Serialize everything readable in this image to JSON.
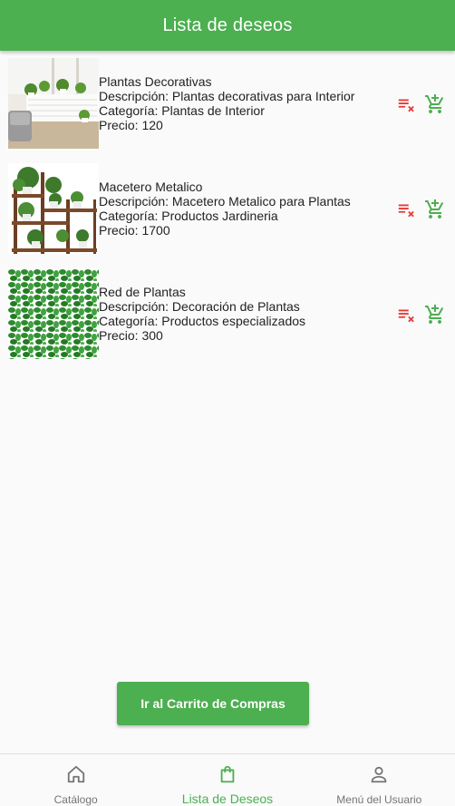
{
  "colors": {
    "primary": "#4caf50",
    "danger": "#e53935",
    "muted": "#757575"
  },
  "app_bar": {
    "title": "Lista de deseos"
  },
  "wishlist": [
    {
      "name": "Plantas Decorativas",
      "description": "Descripción: Plantas decorativas para Interior",
      "category": "Categoría: Plantas de Interior",
      "price": "Precio: 120",
      "image": "room-with-potted-plants"
    },
    {
      "name": "Macetero Metalico",
      "description": "Descripción: Macetero Metalico para Plantas",
      "category": "Categoría: Productos Jardineria",
      "price": "Precio: 1700",
      "image": "plant-shelf-stand"
    },
    {
      "name": "Red de Plantas",
      "description": "Descripción: Decoración de Plantas",
      "category": "Categoría: Productos especializados",
      "price": "Precio: 300",
      "image": "ivy-leaf-net"
    }
  ],
  "item_icons": {
    "remove": "playlist-remove-icon",
    "cart": "add-shopping-cart-icon"
  },
  "cta": {
    "label": "Ir al Carrito de Compras"
  },
  "bottom_nav": [
    {
      "label": "Catálogo",
      "icon": "home-icon",
      "active": false
    },
    {
      "label": "Lista de Deseos",
      "icon": "shopping-bag-icon",
      "active": true
    },
    {
      "label": "Menú del Usuario",
      "icon": "person-icon",
      "active": false
    }
  ]
}
